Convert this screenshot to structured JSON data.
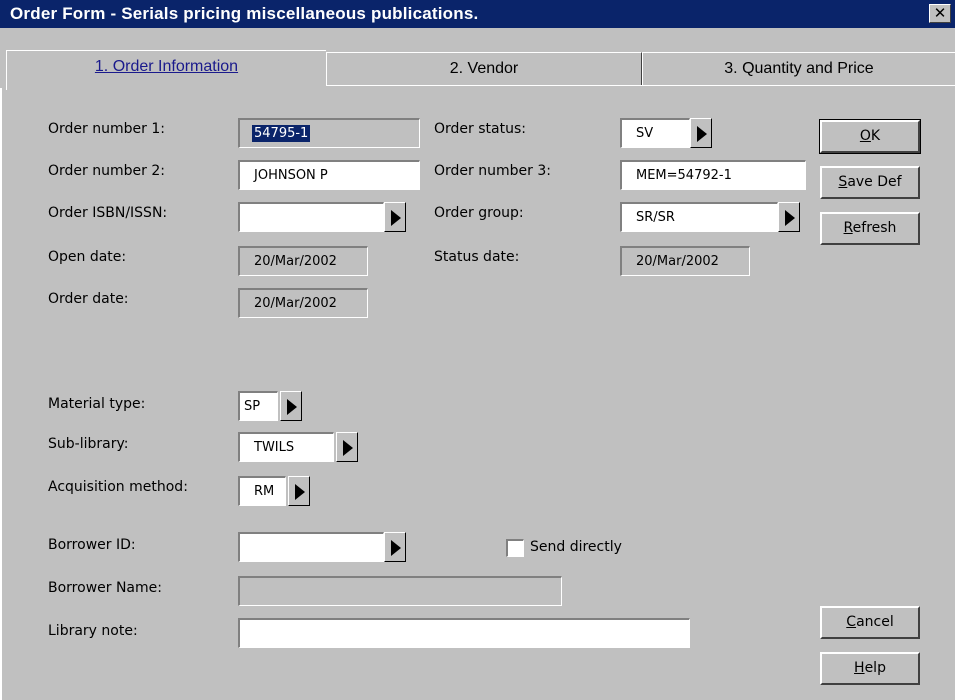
{
  "window": {
    "title": "Order Form - Serials pricing miscellaneous publications.",
    "close_glyph": "✕"
  },
  "tabs": [
    {
      "label": "1. Order Information"
    },
    {
      "label": "2. Vendor"
    },
    {
      "label": "3. Quantity and Price"
    }
  ],
  "form": {
    "order_number_1": {
      "label": "Order number 1:",
      "value": "54795-1"
    },
    "order_number_2": {
      "label": "Order number 2:",
      "value": "JOHNSON P"
    },
    "order_isbn": {
      "label": "Order ISBN/ISSN:",
      "value": ""
    },
    "open_date": {
      "label": "Open date:",
      "value": "20/Mar/2002"
    },
    "order_date": {
      "label": "Order date:",
      "value": "20/Mar/2002"
    },
    "order_status": {
      "label": "Order status:",
      "value": "SV"
    },
    "order_number_3": {
      "label": "Order number 3:",
      "value": "MEM=54792-1"
    },
    "order_group": {
      "label": "Order group:",
      "value": "SR/SR"
    },
    "status_date": {
      "label": "Status date:",
      "value": "20/Mar/2002"
    },
    "material_type": {
      "label": "Material type:",
      "value": "SP"
    },
    "sub_library": {
      "label": "Sub-library:",
      "value": "TWILS"
    },
    "acquisition_method": {
      "label": "Acquisition method:",
      "value": "RM"
    },
    "borrower_id": {
      "label": "Borrower ID:",
      "value": ""
    },
    "send_directly": {
      "label": "Send directly",
      "checked": false
    },
    "borrower_name": {
      "label": "Borrower Name:",
      "value": ""
    },
    "library_note": {
      "label": "Library note:",
      "value": ""
    }
  },
  "buttons": {
    "ok": {
      "mnemonic": "O",
      "rest": "K"
    },
    "save_def": {
      "mnemonic": "S",
      "rest": "ave Def"
    },
    "refresh": {
      "mnemonic": "R",
      "rest": "efresh"
    },
    "cancel": {
      "mnemonic": "C",
      "rest": "ancel"
    },
    "help": {
      "mnemonic": "H",
      "rest": "elp"
    }
  },
  "colors": {
    "titlebar": "#0a246a",
    "face": "#c0c0c0",
    "selection": "#0a246a"
  }
}
